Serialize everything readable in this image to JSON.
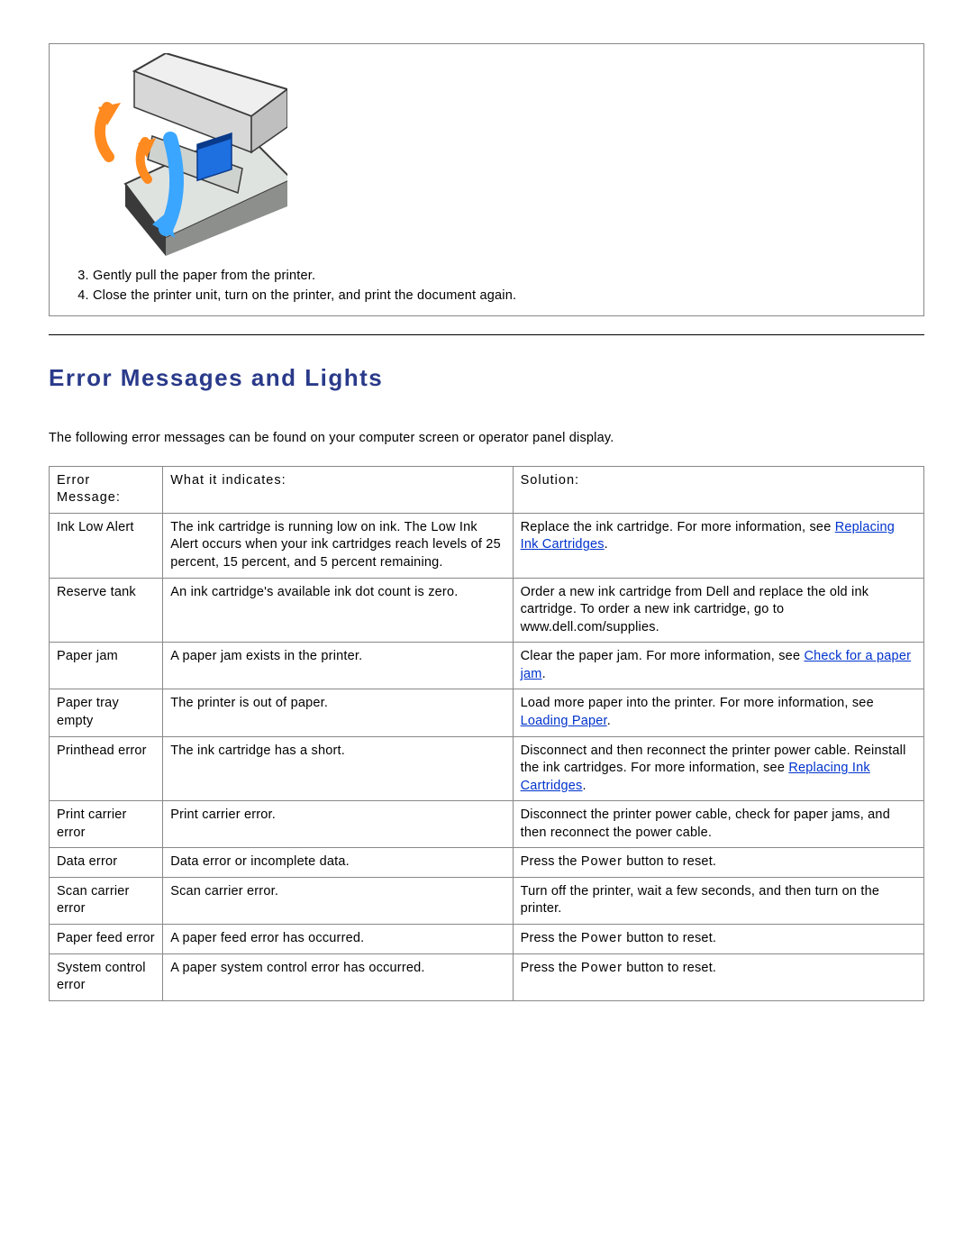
{
  "steps": {
    "start": 3,
    "items": [
      "Gently pull the paper from the printer.",
      "Close the printer unit, turn on the printer, and print the document again."
    ]
  },
  "section_title": "Error Messages and Lights",
  "intro": "The following error messages can be found on your computer screen or operator panel display.",
  "table": {
    "headers": {
      "message": "Error Message:",
      "indicates": "What it indicates:",
      "solution": "Solution:"
    },
    "rows": [
      {
        "message": "Ink Low Alert",
        "indicates": "The ink cartridge is running low on ink. The Low Ink Alert occurs when your ink cartridges reach levels of 25 percent, 15 percent, and 5 percent remaining.",
        "solution_pre": "Replace the ink cartridge. For more information, see ",
        "solution_link": "Replacing Ink Cartridges",
        "solution_post": "."
      },
      {
        "message": "Reserve tank",
        "indicates": "An ink cartridge's available ink dot count is zero.",
        "solution_pre": "Order a new ink cartridge from Dell and replace the old ink cartridge. To order a new ink cartridge, go to www.dell.com/supplies.",
        "solution_link": "",
        "solution_post": ""
      },
      {
        "message": "Paper jam",
        "indicates": "A paper jam exists in the printer.",
        "solution_pre": "Clear the paper jam. For more information, see ",
        "solution_link": "Check for a paper jam",
        "solution_post": "."
      },
      {
        "message": "Paper tray empty",
        "indicates": "The printer is out of paper.",
        "solution_pre": "Load more paper into the printer. For more information, see ",
        "solution_link": "Loading Paper",
        "solution_post": "."
      },
      {
        "message": "Printhead error",
        "indicates": "The ink cartridge has a short.",
        "solution_pre": "Disconnect and then reconnect the printer power cable. Reinstall the ink cartridges. For more information, see ",
        "solution_link": "Replacing Ink Cartridges",
        "solution_post": "."
      },
      {
        "message": "Print carrier error",
        "indicates": "Print carrier error.",
        "solution_pre": "Disconnect the printer power cable, check for paper jams, and then reconnect the power cable.",
        "solution_link": "",
        "solution_post": ""
      },
      {
        "message": "Data error",
        "indicates": "Data error or incomplete data.",
        "solution_pre": "Press the ",
        "solution_link": "",
        "solution_post": "",
        "solution_bold": "Power",
        "solution_tail": " button to reset."
      },
      {
        "message": "Scan carrier error",
        "indicates": "Scan carrier error.",
        "solution_pre": "Turn off the printer, wait a few seconds, and then turn on the printer.",
        "solution_link": "",
        "solution_post": ""
      },
      {
        "message": "Paper feed error",
        "indicates": "A paper feed error has occurred.",
        "solution_pre": "Press the ",
        "solution_link": "",
        "solution_post": "",
        "solution_bold": "Power",
        "solution_tail": " button to reset."
      },
      {
        "message": "System control error",
        "indicates": "A paper system control error has occurred.",
        "solution_pre": "Press the ",
        "solution_link": "",
        "solution_post": "",
        "solution_bold": "Power",
        "solution_tail": " button to reset."
      }
    ]
  }
}
